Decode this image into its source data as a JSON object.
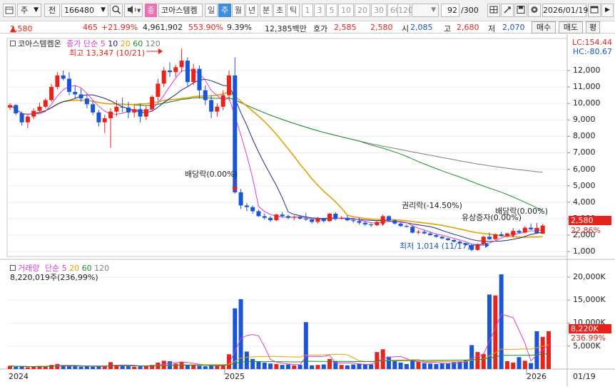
{
  "toolbar": {
    "type_label": "주",
    "jeon_label": "전",
    "code": "166480",
    "badge": "종",
    "name": "코아스템켐",
    "periods": [
      "일",
      "주",
      "월",
      "년",
      "분",
      "초",
      "틱"
    ],
    "active_period": "주",
    "numbers": [
      "1",
      "3",
      "5",
      "10",
      "20",
      "30",
      "60",
      "120"
    ],
    "count": "92",
    "count_total": "/300",
    "date": "2026/01/19"
  },
  "info": {
    "price": "2,580",
    "change": "465",
    "change_pct": "+21.99%",
    "volume": "4,961,902",
    "volume_pct": "553.90%",
    "turnover": "9.39%",
    "amount": "12,385백만",
    "quote_label": "호가",
    "ask": "2,585",
    "bid": "2,580",
    "open_label": "시",
    "open": "2,085",
    "high_label": "고",
    "high": "2,680",
    "low_label": "저",
    "low": "2,070",
    "buy": "매수",
    "sell": "매도",
    "eval": "평"
  },
  "legend": {
    "name": "코아스템켐온",
    "price_ma": [
      "종가",
      "단순",
      "5",
      "10",
      "20",
      "60",
      "120"
    ],
    "max_label": "최고 13,347 (10/21)",
    "min_label": "최저 1,014 (11/17)",
    "lc": "LC:154.44",
    "hc": "HC:-80.67",
    "vol_ma": [
      "거래량",
      "단순",
      "5",
      "20",
      "60",
      "120"
    ],
    "vol_value": "8,220,019주(236,99%)"
  },
  "annotations": [
    "배당락(0.00%)",
    "권리락(-14.50%)",
    "유상증자(0.00%)",
    "배당락(0.00%)"
  ],
  "price_axis": [
    "12,000",
    "11,000",
    "10,000",
    "9,000",
    "8,000",
    "7,000",
    "6,000",
    "5,000",
    "4,000",
    "3,000",
    "2,000",
    "1,000"
  ],
  "price_tag": "2,580",
  "price_tag_pct": "22.86%",
  "vol_axis": [
    "20,000K",
    "15,000K",
    "10,000K",
    "5,000K"
  ],
  "vol_tag": "8,220K",
  "vol_tag_pct": "236.99%",
  "x_axis": [
    "2024",
    "2025",
    "2026"
  ],
  "x_axis_end": "01/19",
  "colors": {
    "up": "#e8231b",
    "down": "#1a55d6",
    "ma5": "#d63ed6",
    "ma10": "#1d2a86",
    "ma20": "#e6a100",
    "ma60": "#1e8f2a",
    "ma120": "#7d7d7d"
  },
  "chart_data": [
    {
      "type": "candlestick",
      "title": "",
      "ylim": [
        700,
        13600
      ],
      "categories_hint": "weekly, 2024-01 to 2026-01",
      "candles": [
        [
          9750,
          10000,
          9600,
          9900
        ],
        [
          9900,
          9950,
          9300,
          9400
        ],
        [
          9400,
          9500,
          8650,
          8850
        ],
        [
          8850,
          9300,
          8500,
          9200
        ],
        [
          9200,
          9700,
          9050,
          9550
        ],
        [
          9550,
          10050,
          9450,
          9800
        ],
        [
          9800,
          10300,
          9700,
          10200
        ],
        [
          10200,
          11200,
          10100,
          11000
        ],
        [
          11000,
          11900,
          10850,
          11700
        ],
        [
          11700,
          12000,
          11400,
          11500
        ],
        [
          11500,
          11900,
          10500,
          10700
        ],
        [
          10700,
          11100,
          10300,
          10550
        ],
        [
          10550,
          10900,
          10100,
          10300
        ],
        [
          10300,
          10550,
          9700,
          9950
        ],
        [
          9950,
          10150,
          9300,
          9450
        ],
        [
          9450,
          9600,
          8600,
          8850
        ],
        [
          8850,
          9300,
          8200,
          9100
        ],
        [
          9100,
          9700,
          7300,
          9500
        ],
        [
          9500,
          10200,
          9200,
          9800
        ],
        [
          9800,
          10350,
          9450,
          9750
        ],
        [
          9750,
          10100,
          9100,
          9450
        ],
        [
          9450,
          9900,
          9150,
          9650
        ],
        [
          9650,
          10000,
          8850,
          9200
        ],
        [
          9200,
          9850,
          9000,
          9650
        ],
        [
          9650,
          10500,
          9500,
          10400
        ],
        [
          10400,
          11500,
          10150,
          11200
        ],
        [
          11200,
          12200,
          11000,
          12000
        ],
        [
          12000,
          12500,
          11600,
          11900
        ],
        [
          11900,
          12350,
          11600,
          12200
        ],
        [
          12200,
          13347,
          11900,
          12600
        ],
        [
          12600,
          12800,
          11000,
          11300
        ],
        [
          11300,
          12400,
          11100,
          12100
        ],
        [
          12100,
          12300,
          10300,
          10800
        ],
        [
          10800,
          11100,
          9900,
          10200
        ],
        [
          10200,
          10500,
          9100,
          9500
        ],
        [
          9500,
          10000,
          9200,
          9800
        ],
        [
          9800,
          10800,
          9600,
          10500
        ],
        [
          10500,
          12000,
          10200,
          11700
        ],
        [
          11700,
          12800,
          4500,
          4600
        ],
        [
          4600,
          4800,
          3600,
          3800
        ],
        [
          3800,
          3950,
          3450,
          3700
        ],
        [
          3700,
          3800,
          3300,
          3450
        ],
        [
          3450,
          3550,
          3100,
          3150
        ],
        [
          3150,
          3300,
          2950,
          3050
        ],
        [
          3050,
          3150,
          2800,
          2900
        ],
        [
          2900,
          3300,
          2850,
          3250
        ],
        [
          3250,
          3400,
          3050,
          3150
        ],
        [
          3150,
          3250,
          2950,
          3050
        ],
        [
          3050,
          3200,
          2900,
          3100
        ],
        [
          3100,
          3200,
          2950,
          3000
        ],
        [
          3000,
          3350,
          2850,
          2950
        ],
        [
          2950,
          3050,
          2700,
          2800
        ],
        [
          2800,
          3100,
          2700,
          3000
        ],
        [
          3000,
          3050,
          2750,
          2850
        ],
        [
          2850,
          3350,
          2800,
          3300
        ],
        [
          3300,
          3400,
          2900,
          3000
        ],
        [
          3000,
          3150,
          2950,
          3050
        ],
        [
          3050,
          3200,
          2850,
          2900
        ],
        [
          2900,
          3000,
          2750,
          2850
        ],
        [
          2850,
          3050,
          2650,
          2750
        ],
        [
          2750,
          2850,
          2550,
          2650
        ],
        [
          2650,
          2750,
          2500,
          2600
        ],
        [
          2600,
          2850,
          2550,
          2800
        ],
        [
          2800,
          3250,
          2750,
          3150
        ],
        [
          3150,
          3200,
          2850,
          2900
        ],
        [
          2900,
          2950,
          2650,
          2700
        ],
        [
          2700,
          2750,
          2500,
          2550
        ],
        [
          2550,
          2650,
          2450,
          2500
        ],
        [
          2500,
          2600,
          2100,
          2150
        ],
        [
          2150,
          2300,
          2050,
          2200
        ],
        [
          2200,
          2300,
          2050,
          2100
        ],
        [
          2100,
          2200,
          1950,
          2000
        ],
        [
          2000,
          2100,
          1850,
          1900
        ],
        [
          1900,
          1950,
          1750,
          1800
        ],
        [
          1800,
          1850,
          1650,
          1700
        ],
        [
          1700,
          1750,
          1550,
          1600
        ],
        [
          1600,
          1650,
          1450,
          1500
        ],
        [
          1500,
          1550,
          1350,
          1400
        ],
        [
          1400,
          1450,
          1014,
          1100
        ],
        [
          1100,
          1500,
          1050,
          1450
        ],
        [
          1450,
          1950,
          1400,
          1900
        ],
        [
          1900,
          2150,
          1700,
          1750
        ],
        [
          1750,
          2100,
          1700,
          2050
        ],
        [
          2050,
          2200,
          1900,
          1950
        ],
        [
          1950,
          2150,
          1850,
          2100
        ],
        [
          2100,
          2300,
          2000,
          2250
        ],
        [
          2250,
          2350,
          2100,
          2150
        ],
        [
          2150,
          2550,
          2100,
          2450
        ],
        [
          2450,
          2700,
          2300,
          2350
        ],
        [
          2350,
          2500,
          2100,
          2115
        ],
        [
          2085,
          2680,
          2070,
          2580
        ]
      ]
    },
    {
      "type": "bar",
      "title": "거래량",
      "ylim": [
        0,
        22000
      ],
      "values": [
        700,
        500,
        600,
        400,
        500,
        700,
        600,
        900,
        1100,
        800,
        700,
        600,
        500,
        600,
        500,
        700,
        600,
        1500,
        900,
        700,
        600,
        500,
        600,
        700,
        900,
        1400,
        1800,
        1700,
        1200,
        1600,
        900,
        800,
        700,
        600,
        800,
        700,
        900,
        3200,
        13200,
        15200,
        3800,
        2200,
        1700,
        1400,
        1200,
        1100,
        900,
        1000,
        800,
        900,
        10200,
        800,
        900,
        1000,
        2200,
        1700,
        900,
        800,
        1000,
        1200,
        1100,
        1000,
        3700,
        4300,
        2700,
        1700,
        1400,
        1100,
        2100,
        1600,
        1300,
        1200,
        1100,
        1200,
        1300,
        1500,
        1700,
        2000,
        5200,
        3700,
        3300,
        16200,
        16000,
        20600,
        1700,
        1400,
        2600,
        1800,
        1300,
        8220,
        7000,
        8220
      ]
    }
  ]
}
